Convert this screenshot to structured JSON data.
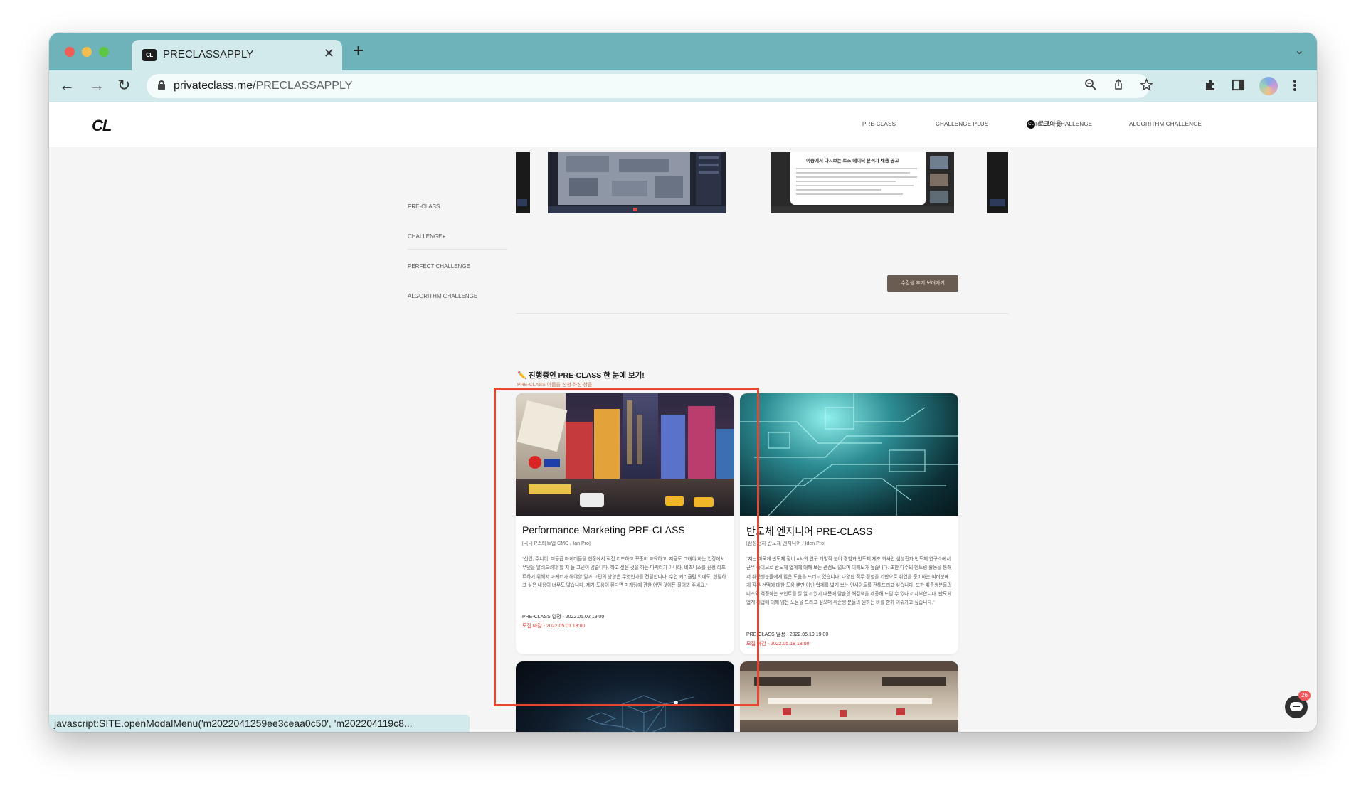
{
  "browser": {
    "tab_title": "PRECLASSAPPLY",
    "tab_favicon": "CL",
    "close_tab_symbol": "✕",
    "new_tab_symbol": "+",
    "tab_menu_symbol": "⌄",
    "url_host": "privateclass.me/",
    "url_path": "PRECLASSAPPLY",
    "status_bar_text": "javascript:SITE.openModalMenu('m2022041259ee3ceaa0c50', 'm202204119c8..."
  },
  "site": {
    "logo": "CL",
    "nav": [
      "PRE-CLASS",
      "CHALLENGE PLUS",
      "PERFECT CHALLENGE",
      "ALGORITHM CHALLENGE"
    ],
    "logout_label": "로그아웃",
    "logout_icon_text": "CL",
    "sidebar": [
      "PRE-CLASS",
      "CHALLENGE+",
      "PERFECT CHALLENGE",
      "ALGORITHM CHALLENGE"
    ],
    "review_button": "수강생 후기 보러가기",
    "doc_preview_title": "이중에서 다시보는 토스 데이터 분석가 채용 공고",
    "section_title": "진행중인 PRE-CLASS 한 눈에 보기!",
    "section_subtitle": "PRE-CLASS 이름을 신청 하신 창을",
    "chat_badge": "26"
  },
  "cards": [
    {
      "title": "Performance Marketing PRE-CLASS",
      "author": "[국내 P스타트업 CMO / Ian Pro]",
      "desc": "\"신입, 주니어, 미들급 마케터들을 현장에서 직접 리드하고 꾸준히 교육하고, 지금도 그래야 하는 입장에서 무엇을 알려드려야 할 지 늘 고민이 많습니다. 하고 싶은 것을 하는 마케터가 아니라, 비즈니스를 진정 리프트하기 위해서 마케터가 해야할 일과 고민의 방향은 무엇인가를 전달합니다. 수업 커리큘럼 외에도, 현달하고 싶은 내용이 너무도 많습니다. 제가 도움이 된다면 마케팅에 관한 어떤 것이든 물어봐 주세요.\"",
      "schedule": "PRE-CLASS 일정 - 2022.05.02 19:00",
      "deadline": "모집 마감 - 2022.05.01 18:00"
    },
    {
      "title": "반도체 엔지니어 PRE-CLASS",
      "author": "[삼성전자 반도체 엔지니어 / Iden Pro]",
      "desc": "\"저는 미국계 반도체 장비 A사의 연구 개발직 분야 경험과 반도체 제조 회사인 삼성전자 반도체 연구소에서 근무 중이므로 반도체 업계에 대해 보는 관점도 넓으며 이해도가 높습니다. 또한 다수의 멘토링 활동을 통해서 취준생분들에게 많은 도움을 드리고 있습니다. 다양한 직무 경험을 기반으로 취업을 준비하는 여러분에게 직무 선택에 대한 도움 뿐만 아닌 업계를 넓게 보는 인사이트를 전해드리고 싶습니다. 또한 취준생분들의 니즈와 걱정하는 포인트를 잘 알고 있기 때문에 맞춤형 해결책을 제공해 드릴 수 있다고 자부합니다. 반도체 업계 취업에 대해 많은 도움을 드리고 싶으며 취준생 분들의 원하는 바를 함께 이뤄가고 싶습니다.\"",
      "schedule": "PRE-CLASS 일정 - 2022.05.19 19:00",
      "deadline": "모집 마감 - 2022.05.18 18:00"
    }
  ],
  "colors": {
    "chrome_tabbar": "#6fb3ba",
    "chrome_toolbar": "#d3eaec",
    "highlight_box": "#e84533",
    "deadline_red": "#e0322c",
    "review_button_bg": "#6b5c51"
  },
  "icons": [
    "close-icon",
    "plus-icon",
    "back-arrow-icon",
    "forward-arrow-icon",
    "reload-icon",
    "lock-icon",
    "zoom-icon",
    "share-icon",
    "star-icon",
    "puzzle-icon",
    "sidepanel-icon",
    "kebab-menu-icon",
    "chat-icon"
  ]
}
